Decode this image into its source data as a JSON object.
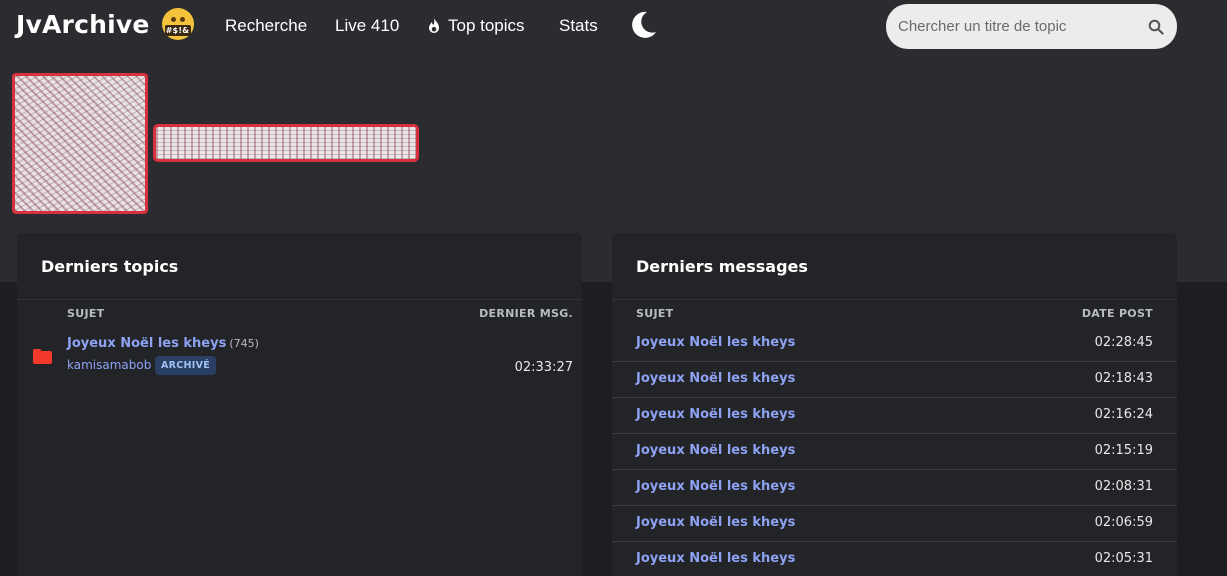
{
  "navbar": {
    "brand": "JvArchive",
    "brand_emoji_text": "#$!&",
    "links": [
      {
        "label": "Recherche"
      },
      {
        "label": "Live 410"
      },
      {
        "label": "Top topics"
      },
      {
        "label": "Stats"
      }
    ],
    "search": {
      "placeholder": "Chercher un titre de topic"
    }
  },
  "latest_topics": {
    "title": "Derniers topics",
    "col_subject": "SUJET",
    "col_last": "DERNIER MSG.",
    "topics": [
      {
        "title": "Joyeux Noël les kheys",
        "count": "(745)",
        "author": "kamisamabob",
        "badge": "ARCHIVÉ",
        "time": "02:33:27"
      }
    ]
  },
  "latest_messages": {
    "title": "Derniers messages",
    "col_subject": "SUJET",
    "col_date": "DATE POST",
    "messages": [
      {
        "title": "Joyeux Noël les kheys",
        "time": "02:28:45"
      },
      {
        "title": "Joyeux Noël les kheys",
        "time": "02:18:43"
      },
      {
        "title": "Joyeux Noël les kheys",
        "time": "02:16:24"
      },
      {
        "title": "Joyeux Noël les kheys",
        "time": "02:15:19"
      },
      {
        "title": "Joyeux Noël les kheys",
        "time": "02:08:31"
      },
      {
        "title": "Joyeux Noël les kheys",
        "time": "02:06:59"
      },
      {
        "title": "Joyeux Noël les kheys",
        "time": "02:05:31"
      }
    ]
  },
  "colors": {
    "link": "#8ea2f4",
    "accent_red": "#d7303e",
    "badge_bg": "#2a3f64"
  },
  "icons": {
    "theme_toggle": "moon-icon",
    "search": "search-icon",
    "top_topics": "fire-icon",
    "topic_status": "folder-icon"
  }
}
